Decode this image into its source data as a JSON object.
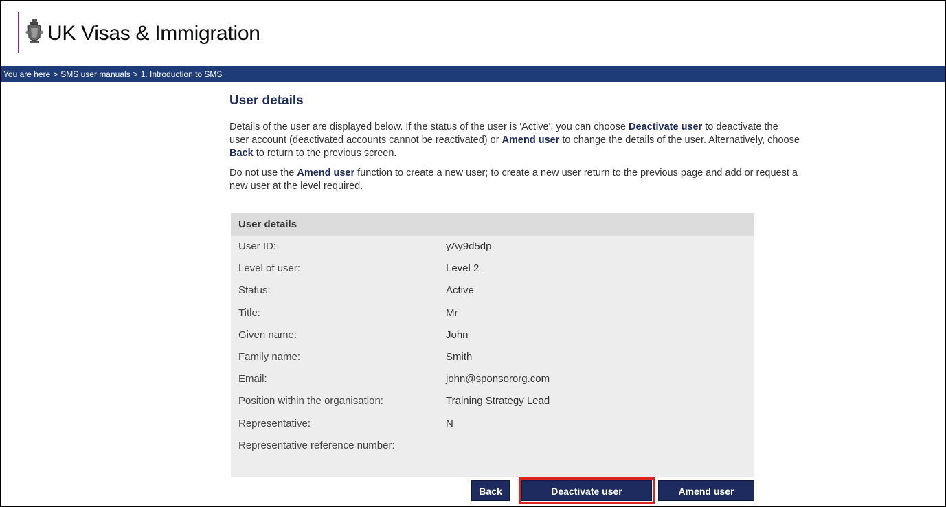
{
  "header": {
    "brand": "UK Visas & Immigration",
    "brand_bar_color": "#8a2a8f",
    "crest_icon": "royal-crest-icon"
  },
  "breadcrumb": {
    "prefix": "You are here",
    "items": [
      "SMS user manuals",
      "1. Introduction to SMS"
    ],
    "bar_color": "#1d3c78"
  },
  "main": {
    "title": "User details",
    "para1": {
      "t1": "Details of the user are displayed below. If the status of the user is 'Active', you can choose ",
      "b1": "Deactivate user",
      "t2": " to deactivate the user account (deactivated accounts cannot be reactivated) or ",
      "b2": "Amend user",
      "t3": " to change the details of the user. Alternatively, choose ",
      "b3": "Back",
      "t4": " to return to the previous screen."
    },
    "para2": {
      "t1": "Do not use the ",
      "b1": "Amend user",
      "t2": " function to create a new user; to create a new user return to the previous page and add or request a new user at the level required."
    }
  },
  "details": {
    "heading": "User details",
    "rows": [
      {
        "label": "User ID:",
        "value": "yAy9d5dp"
      },
      {
        "label": "Level of user:",
        "value": "Level 2"
      },
      {
        "label": "Status:",
        "value": "Active"
      },
      {
        "label": "Title:",
        "value": "Mr"
      },
      {
        "label": "Given name:",
        "value": "John"
      },
      {
        "label": "Family name:",
        "value": "Smith"
      },
      {
        "label": "Email:",
        "value": "john@sponsororg.com"
      },
      {
        "label": "Position within the organisation:",
        "value": "Training Strategy Lead"
      },
      {
        "label": "Representative:",
        "value": "N"
      },
      {
        "label": "Representative reference number:",
        "value": ""
      }
    ]
  },
  "buttons": {
    "back": "Back",
    "deactivate": "Deactivate user",
    "amend": "Amend user",
    "button_color": "#1d2b5e",
    "highlight_color": "#d9261c"
  }
}
